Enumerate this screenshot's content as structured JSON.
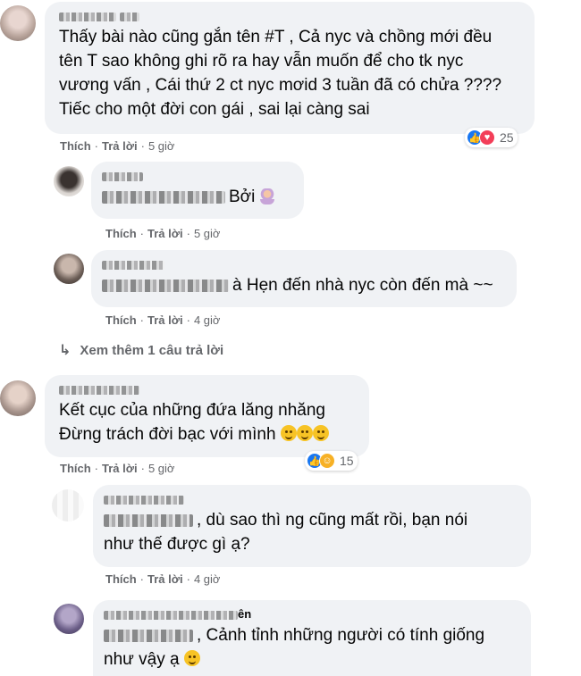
{
  "comments": [
    {
      "text_lines": [
        "Thấy bài nào cũng gắn tên #T , Cả nyc và chồng mới đều",
        "tên T sao không ghi rõ ra hay vẫn muốn để cho tk nyc",
        "vương vấn , Cái thứ 2 ct nyc mơid 3 tuần đã có chửa ????",
        "Tiếc cho một đời con gái , sai lại càng sai"
      ],
      "reaction_count": "25",
      "like_label": "Thích",
      "reply_label": "Trả lời",
      "time": "5 giờ"
    },
    {
      "text": "Bởi",
      "like_label": "Thích",
      "reply_label": "Trả lời",
      "time": "5 giờ"
    },
    {
      "text": "à Hẹn đến nhà nyc còn đến mà ~~",
      "like_label": "Thích",
      "reply_label": "Trả lời",
      "time": "4 giờ"
    },
    {
      "text_lines": [
        "Kết cục của những đứa lăng nhăng",
        "Đừng trách đời bạc với mình"
      ],
      "reaction_count": "15",
      "like_label": "Thích",
      "reply_label": "Trả lời",
      "time": "5 giờ"
    },
    {
      "text_lines": [
        ", dù sao thì ng cũng mất rồi, bạn nói",
        "như thế được gì ạ?"
      ],
      "like_label": "Thích",
      "reply_label": "Trả lời",
      "time": "4 giờ"
    },
    {
      "name_suffix": "ên",
      "text_lines": [
        ", Cảnh tỉnh những người có tính giống",
        "như vậy ạ"
      ]
    }
  ],
  "see_more_replies": "Xem thêm 1 câu trả lời",
  "colors": {
    "bubble": "#f0f2f5",
    "meta_text": "#65676b",
    "like_blue": "#1877f2",
    "love_red": "#f33e58",
    "haha_yellow": "#f7b125"
  }
}
